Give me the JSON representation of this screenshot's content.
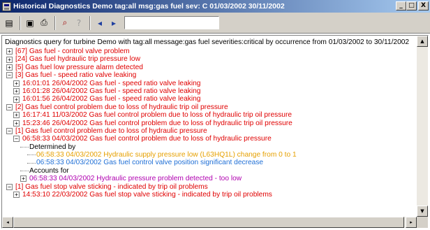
{
  "window": {
    "title": "Historical Diagnostics  Demo tag:all msg:gas fuel sev: C 01/03/2002 30/11/2002",
    "minimize": "_",
    "restore": "□",
    "close": "X"
  },
  "toolbar": {
    "buttons": [
      {
        "icon": "properties-icon",
        "glyph": "▤"
      },
      {
        "icon": "save-icon",
        "glyph": "▣"
      },
      {
        "icon": "print-icon",
        "glyph": "⎙"
      },
      {
        "icon": "find-icon",
        "glyph": "⌕"
      },
      {
        "icon": "help-icon",
        "glyph": "?"
      },
      {
        "icon": "previous-icon",
        "glyph": "◂"
      },
      {
        "icon": "next-icon",
        "glyph": "▸"
      }
    ],
    "search_value": ""
  },
  "tree": {
    "header": "Diagnostics query for turbine Demo with tag:all message:gas fuel severities:critical by occurrence from 01/03/2002 to 30/11/2002",
    "rows": [
      {
        "text": "[67] Gas fuel - control valve problem",
        "level": 1,
        "expander": "+",
        "color": "red"
      },
      {
        "text": "[24] Gas fuel hydraulic trip pressure low",
        "level": 1,
        "expander": "+",
        "color": "red"
      },
      {
        "text": "[5] Gas fuel low pressure alarm detected",
        "level": 1,
        "expander": "+",
        "color": "red"
      },
      {
        "text": "[3] Gas fuel - speed ratio valve leaking",
        "level": 1,
        "expander": "−",
        "color": "red"
      },
      {
        "text": "16:01:01 26/04/2002 Gas fuel - speed ratio valve leaking",
        "level": 2,
        "expander": "+",
        "color": "red"
      },
      {
        "text": "16:01:28 26/04/2002 Gas fuel - speed ratio valve leaking",
        "level": 2,
        "expander": "+",
        "color": "red"
      },
      {
        "text": "16:01:56 26/04/2002 Gas fuel - speed ratio valve leaking",
        "level": 2,
        "expander": "+",
        "color": "red"
      },
      {
        "text": "[2] Gas fuel control problem due to loss of hydraulic trip oil pressure",
        "level": 1,
        "expander": "−",
        "color": "red"
      },
      {
        "text": "16:17:41 11/03/2002 Gas fuel control problem due to loss of hydraulic trip oil pressure",
        "level": 2,
        "expander": "+",
        "color": "red"
      },
      {
        "text": "15:23:46 26/04/2002 Gas fuel control problem due to loss of hydraulic trip oil pressure",
        "level": 2,
        "expander": "+",
        "color": "red"
      },
      {
        "text": "[1] Gas fuel control problem due to loss of hydraulic pressure",
        "level": 1,
        "expander": "−",
        "color": "red"
      },
      {
        "text": "06:58:33 04/03/2002 Gas fuel control problem due to loss of hydraulic pressure",
        "level": 2,
        "expander": "−",
        "color": "red"
      },
      {
        "text": "Determined by",
        "level": 3,
        "expander": "",
        "color": "black"
      },
      {
        "text": "06:58:33 04/03/2002 Hydraulic supply pressure low (L63HQ1L) change from 0 to 1",
        "level": 4,
        "expander": "",
        "color": "orange"
      },
      {
        "text": "06:58:33 04/03/2002 Gas fuel control valve position significant decrease",
        "level": 4,
        "expander": "",
        "color": "blue"
      },
      {
        "text": "Accounts for",
        "level": 3,
        "expander": "",
        "color": "black"
      },
      {
        "text": "06:58:33 04/03/2002 Hydraulic pressure problem detected - too low",
        "level": 3,
        "expander": "+",
        "color": "purple"
      },
      {
        "text": "[1] Gas fuel stop valve sticking - indicated by trip oil problems",
        "level": 1,
        "expander": "−",
        "color": "red"
      },
      {
        "text": "14:53:10 22/03/2002 Gas fuel stop valve sticking - indicated by trip oil problems",
        "level": 2,
        "expander": "+",
        "color": "red"
      }
    ]
  },
  "scrollbars": {
    "up": "▲",
    "down": "▼",
    "left": "◂",
    "right": "▸"
  }
}
